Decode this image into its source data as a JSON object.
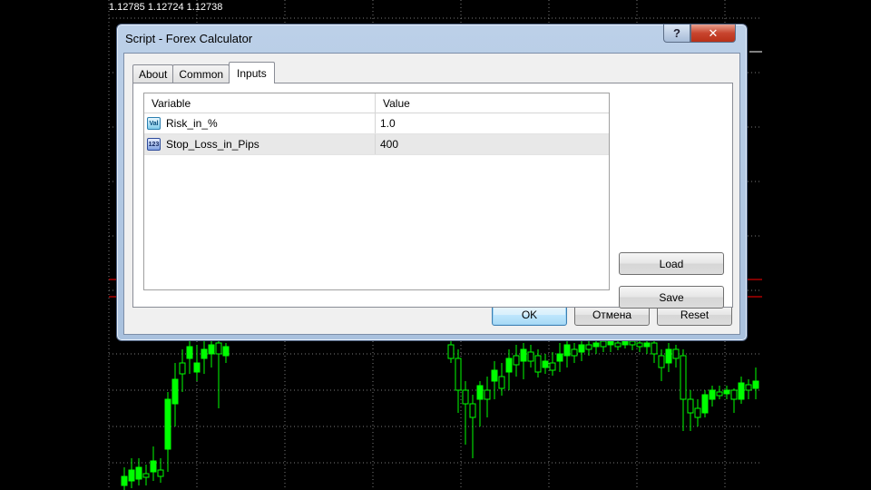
{
  "chart": {
    "price_readout": "1.12785 1.12724 1.12738",
    "colors": {
      "bull": "#00ff00",
      "bear": "#ffffff",
      "grid": "#7a7a7a",
      "level": "#ff0000",
      "background": "#000000"
    }
  },
  "window": {
    "title": "Script - Forex Calculator",
    "help_label": "?",
    "close_label": "✕"
  },
  "tabs": [
    {
      "label": "About"
    },
    {
      "label": "Common"
    },
    {
      "label": "Inputs"
    }
  ],
  "active_tab": "Inputs",
  "table": {
    "headers": {
      "variable": "Variable",
      "value": "Value"
    },
    "rows": [
      {
        "icon": "double-type-icon",
        "icon_text": "Val",
        "variable": "Risk_in_%",
        "value": "1.0"
      },
      {
        "icon": "integer-type-icon",
        "icon_text": "123",
        "variable": "Stop_Loss_in_Pips",
        "value": "400"
      }
    ]
  },
  "buttons": {
    "load": "Load",
    "save": "Save",
    "ok": "OK",
    "cancel": "Отмена",
    "reset": "Reset"
  },
  "annotation_color": "#e8454a"
}
